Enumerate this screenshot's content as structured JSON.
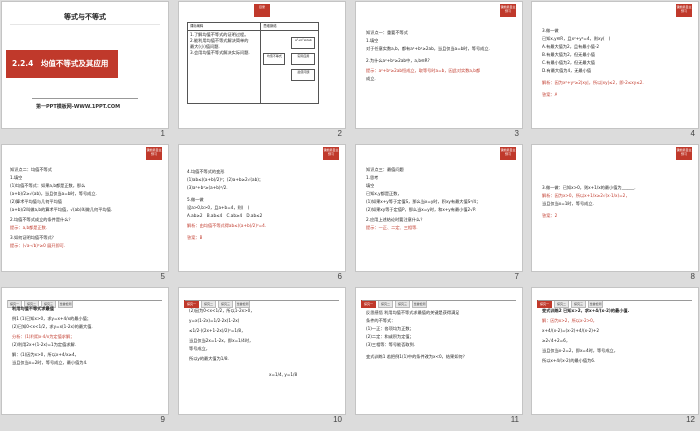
{
  "slides": [
    {
      "num": "1",
      "top_title": "等式与不等式",
      "banner": "2.2.4　均值不等式及其应用",
      "footer": "第一PPT模板网-WWW.1PPT.COM"
    },
    {
      "num": "2",
      "badge": "目录",
      "map_head_left": "课标阐释",
      "map_head_right": "思维脉络",
      "map_body": [
        "1.了解均值不等式的证明过程。",
        "2.能利用均值不等式解决简单的",
        "最大(小)值问题.",
        "3.会用均值不等式解决实际问题.",
        ""
      ],
      "boxes": [
        "均值不等式",
        "a²+b²≥2ab",
        "实际应用",
        "最值问题"
      ]
    },
    {
      "num": "3",
      "badge": "课前篇自主预习",
      "lines": [
        "知识点一：重要不等式",
        "1.填空",
        "对于任意实数a,b，都有a²+b²≥2ab，当且仅当a=b时，等号成立.",
        "2.为什么a²+b²≥2ab中，a,b∈R?",
        "提示：a²+b²≥2ab恒成立，取等号时a=b，因此对实数a,b都",
        "成立."
      ]
    },
    {
      "num": "4",
      "badge": "课前篇自主预习",
      "lines": [
        "3.做一做",
        "已知x,y∈R，且x²+y²=4，则xy(　)",
        "A.有最大值为2，且有最小值-2",
        "B.有最大值为2，但无最小值",
        "C.有最小值为2，但无最大值",
        "D.有最大值为4，无最小值",
        "解析：因为x²+y²≥2|xy|，所以|xy|≤2，即-2≤xy≤2.",
        "答案：A"
      ]
    },
    {
      "num": "5",
      "badge": "课前篇自主预习",
      "lines": [
        "知识点二：均值不等式",
        "1.填空",
        "(1)均值不等式：如果a,b都是正数，那么",
        "(a+b)/2≥√(ab)，当且仅当a=b时，等号成立.",
        "(2)算术平均值与几何平均值",
        "(a+b)/2叫做a,b的算术平均值，√(ab)叫做几何平均值.",
        "2.均值不等式成立的条件是什么？",
        "提示：a,b都是正数.",
        "3.如何证明均值不等式？",
        "提示：(√a-√b)²≥0 展开即可."
      ]
    },
    {
      "num": "6",
      "badge": "课前篇自主预习",
      "lines": [
        "4.均值不等式的变形",
        "(1)ab≤((a+b)/2)²；(2)a+b≥2√(ab)；",
        "(3)a²+b²≥(a+b)²/2.",
        "5.做一做",
        "设a>0,b>0，且a+b=4，则(　)",
        "A.ab≥2　B.ab≤4　C.ab≥4　D.ab≤2",
        "解析：由均值不等式得ab≤((a+b)/2)²=4.",
        "答案：B"
      ]
    },
    {
      "num": "7",
      "badge": "课前篇自主预习",
      "lines": [
        "知识点三：最值问题",
        "1.思考",
        "填空",
        "已知x,y都是正数，",
        "(1)如果x+y等于定值S，那么当x=y时，积xy有最大值S²/4；",
        "(2)如果xy等于定值P，那么当x=y时，和x+y有最小值2√P.",
        "2.应用上述结论时要注意什么？",
        "提示：一正、二定、三相等."
      ]
    },
    {
      "num": "8",
      "badge": "课前篇自主预习",
      "lines": [
        "3.做一做：已知x>0，则x+1/x的最小值为______.",
        "解析：因为x>0，所以x+1/x≥2√(x·1/x)=2，",
        "当且仅当x=1时，等号成立.",
        "答案：2"
      ]
    },
    {
      "num": "9",
      "tabs": [
        "探究一",
        "探究二",
        "探究三",
        "当堂检测"
      ],
      "lines": [
        "利用均值不等式求最值",
        "例1 (1)已知x>0，求y=x+4/x的最小值；",
        "(2)已知0<x<1/2，求y=x(1-2x)的最大值.",
        "分析：(1)利用x·4/x为定值求解；",
        "(2)利用2x+(1-2x)=1为定值求解.",
        "解：(1)因为x>0，所以x+4/x≥4，",
        "当且仅当x=2时，等号成立，最小值为4."
      ]
    },
    {
      "num": "10",
      "tabs": [
        "探究一",
        "探究二",
        "探究三",
        "当堂检测"
      ],
      "lines": [
        "(2)因为0<x<1/2，所以1-2x>0，",
        "y=x(1-2x)=1/2·2x(1-2x)",
        "≤1/2·((2x+1-2x)/2)²=1/8，",
        "当且仅当2x=1-2x，即x=1/4时，",
        "等号成立，",
        "所以y的最大值为1/8.",
        "x=1/4,  y=1/8"
      ]
    },
    {
      "num": "11",
      "tabs": [
        "探究一",
        "探究二",
        "探究三",
        "当堂检测"
      ],
      "lines": [
        "反思感悟 利用均值不等式求最值的关键是获得满足",
        "条件的不等式：",
        "(1)一正：各项均为正数；",
        "(2)二定：和或积为定值；",
        "(3)三相等：等号能否取到.",
        "变式训练1 若把例1(1)中的条件改为x<0，结果如何？"
      ]
    },
    {
      "num": "12",
      "tabs": [
        "探究一",
        "探究二",
        "探究三",
        "当堂检测"
      ],
      "lines": [
        "变式训练2 已知x>2，求x+4/(x-2)的最小值.",
        "解：因为x>2，所以x-2>0，",
        "x+4/(x-2)=(x-2)+4/(x-2)+2",
        "≥2√4+2=6，",
        "当且仅当x-2=2，即x=4时，等号成立，",
        "所以x+4/(x-2)的最小值为6."
      ]
    }
  ]
}
